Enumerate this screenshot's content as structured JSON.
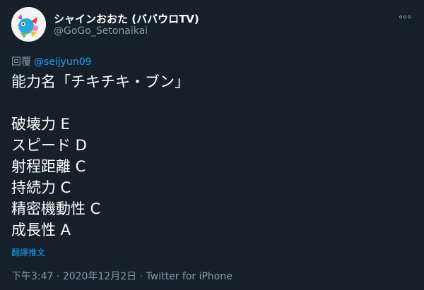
{
  "author": {
    "display_name": "シャインおおた (ババウロTV)",
    "handle": "@GoGo_Setonaikai"
  },
  "reply": {
    "label": "回覆",
    "to": "@seijyun09"
  },
  "body_lines": [
    "能力名「チキチキ・ブン」",
    "",
    "破壊力 E",
    "スピード D",
    "射程距離 C",
    "持続力 C",
    "精密機動性 C",
    "成長性 A"
  ],
  "translate_label": "翻譯推文",
  "meta": {
    "time": "下午3:47",
    "sep1": " · ",
    "date": "2020年12月2日",
    "sep2": " · ",
    "source": "Twitter for iPhone"
  },
  "icons": {
    "more": "more-icon",
    "avatar": "avatar"
  },
  "colors": {
    "background": "#15202b",
    "text": "#ffffff",
    "secondary": "#8899a6",
    "accent": "#1da1f2"
  }
}
